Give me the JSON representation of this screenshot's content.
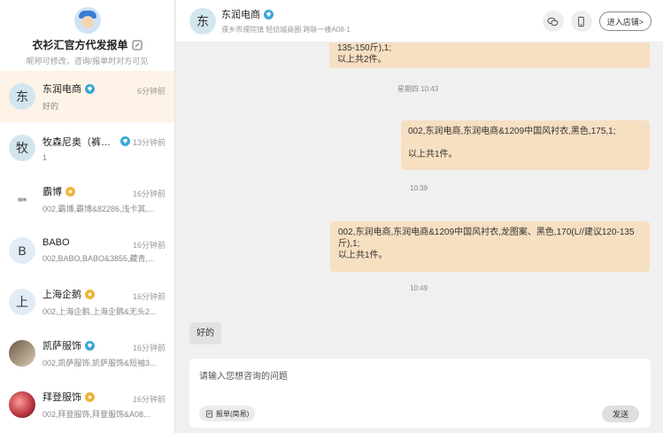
{
  "profile": {
    "name": "衣衫汇官方代发报单",
    "hint": "昵称可修改，咨询/报单时对方可见"
  },
  "conversations": [
    {
      "avatar_text": "东",
      "name": "东润电商",
      "badge": "diamond",
      "time": "6分钟前",
      "preview": "好的"
    },
    {
      "avatar_text": "牧",
      "name": "牧森尼奥（裤子...",
      "badge": "diamond",
      "time": "13分钟前",
      "preview": "1"
    },
    {
      "avatar_text": "",
      "name": "霸博",
      "badge": "gold",
      "time": "16分钟前",
      "preview": "002,霸博,霸博&82286,浅卡其,..."
    },
    {
      "avatar_text": "B",
      "name": "BABO",
      "badge": "",
      "time": "16分钟前",
      "preview": "002,BABO,BABO&3855,藏青,..."
    },
    {
      "avatar_text": "上",
      "name": "上海企鹅",
      "badge": "gold",
      "time": "16分钟前",
      "preview": "002,上海企鹅,上海企鹅&无头2..."
    },
    {
      "avatar_text": "",
      "name": "凯萨服饰",
      "badge": "diamond",
      "time": "16分钟前",
      "preview": "002,凯萨服饰,凯萨服饰&短袖3..."
    },
    {
      "avatar_text": "",
      "name": "拜登服饰",
      "badge": "gold",
      "time": "16分钟前",
      "preview": "002,拜登服饰,拜登服饰&A08..."
    }
  ],
  "header": {
    "avatar_text": "东",
    "name": "东润电商",
    "address": "濮乡市濮院镇 轻纺城商圈 跨联一楼A08-1",
    "store_button": "进入店铺>"
  },
  "messages": [
    {
      "side": "right",
      "text": "135-150斤),1;\n以上共2件。"
    },
    {
      "timestamp": "星期四 10:43"
    },
    {
      "side": "right",
      "text": "002,东润电商,东润电商&1209中国风衬衣,黑色,175,1;\n\n以上共1件。"
    },
    {
      "timestamp": "10:39"
    },
    {
      "side": "right",
      "text": "002,东润电商,东润电商&1209中国风衬衣,龙图案、黑色,170(L//建议120-135斤),1;\n以上共1件。"
    },
    {
      "timestamp": "10:49"
    },
    {
      "side": "left",
      "text": "好的"
    }
  ],
  "composer": {
    "placeholder": "请输入您想咨询的问题",
    "order_button": "报单(简易)",
    "send_button": "发送"
  }
}
